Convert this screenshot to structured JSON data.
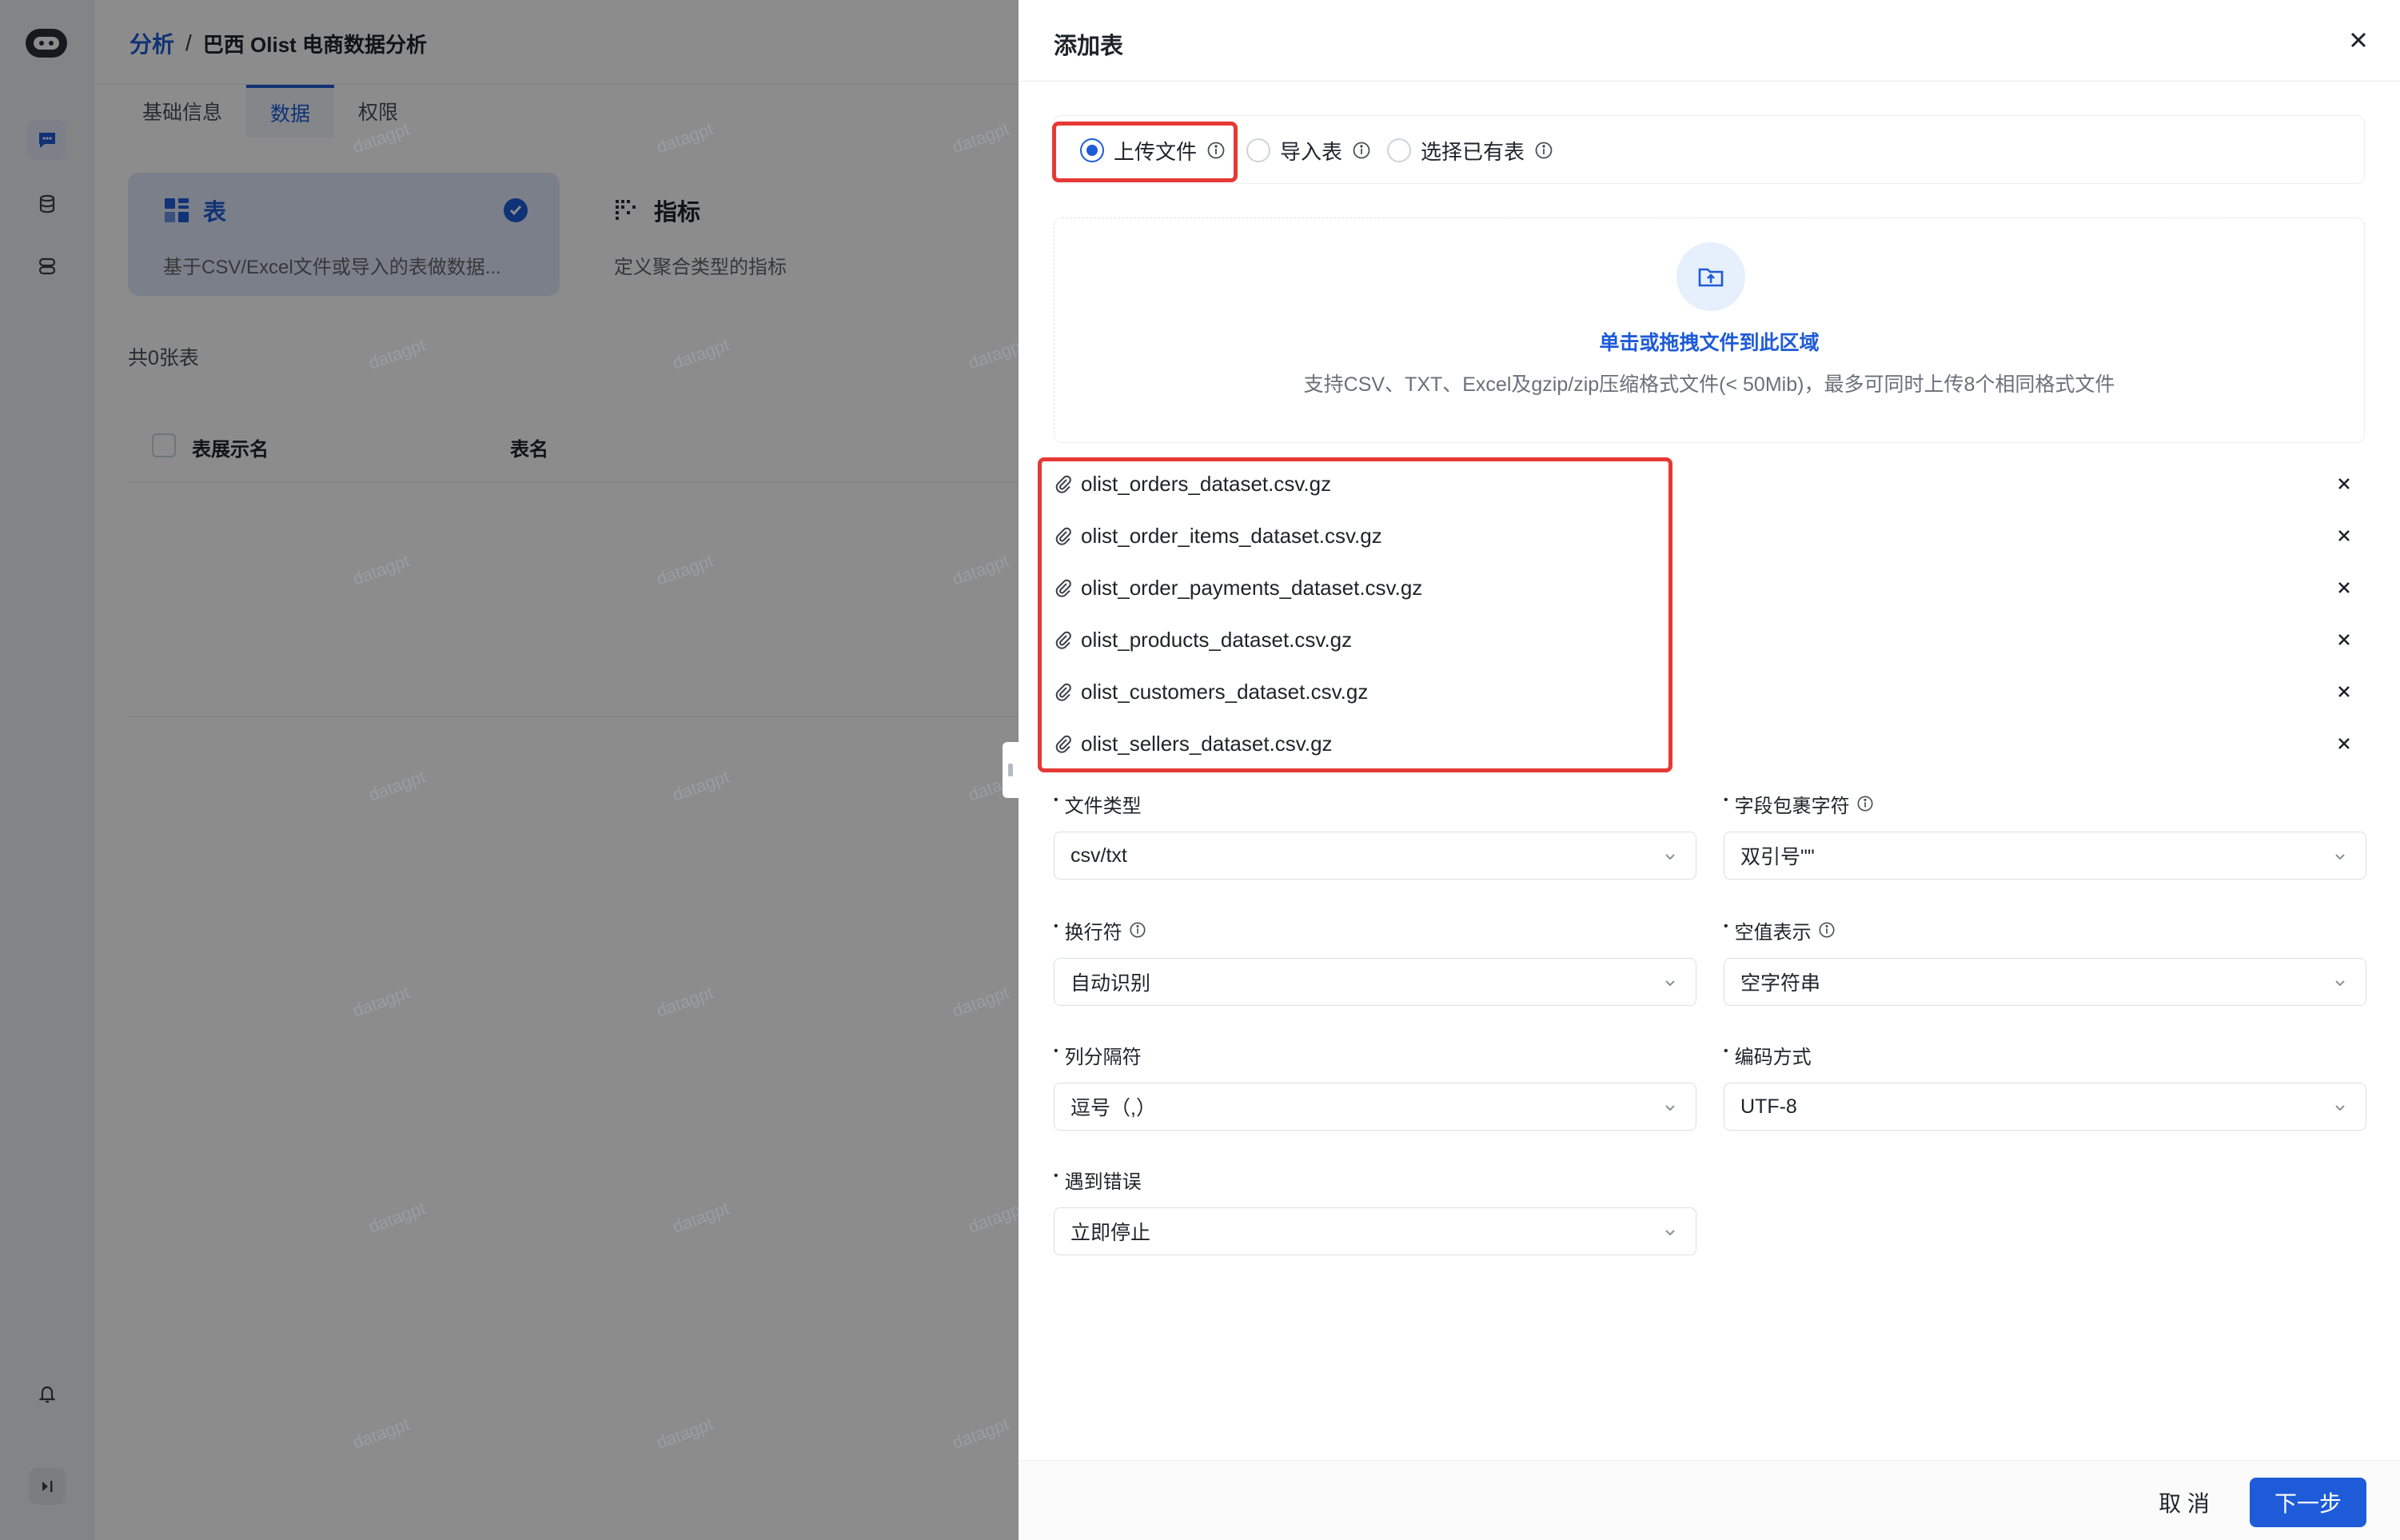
{
  "app": {
    "breadcrumb": {
      "root": "分析",
      "sep": "/",
      "current": "巴西 Olist 电商数据分析"
    },
    "tabs": [
      {
        "label": "基础信息"
      },
      {
        "label": "数据"
      },
      {
        "label": "权限"
      }
    ],
    "cards": [
      {
        "title": "表",
        "desc": "基于CSV/Excel文件或导入的表做数据..."
      },
      {
        "title": "指标",
        "desc": "定义聚合类型的指标"
      }
    ],
    "count_label": "共0张表",
    "table_headers": [
      "表展示名",
      "表名",
      "数据"
    ],
    "watermark": "datagpt"
  },
  "drawer": {
    "title": "添加表",
    "source_options": [
      {
        "label": "上传文件",
        "selected": true
      },
      {
        "label": "导入表",
        "selected": false
      },
      {
        "label": "选择已有表",
        "selected": false
      }
    ],
    "dropzone": {
      "title": "单击或拖拽文件到此区域",
      "subtitle": "支持CSV、TXT、Excel及gzip/zip压缩格式文件(< 50Mib)，最多可同时上传8个相同格式文件"
    },
    "files": [
      "olist_orders_dataset.csv.gz",
      "olist_order_items_dataset.csv.gz",
      "olist_order_payments_dataset.csv.gz",
      "olist_products_dataset.csv.gz",
      "olist_customers_dataset.csv.gz",
      "olist_sellers_dataset.csv.gz"
    ],
    "fields": {
      "file_type": {
        "label": "文件类型",
        "value": "csv/txt"
      },
      "quote_char": {
        "label": "字段包裹字符",
        "value": "双引号\"\""
      },
      "line_sep": {
        "label": "换行符",
        "value": "自动识别"
      },
      "null_repr": {
        "label": "空值表示",
        "value": "空字符串"
      },
      "col_sep": {
        "label": "列分隔符",
        "value": "逗号（,）"
      },
      "encoding": {
        "label": "编码方式",
        "value": "UTF-8"
      },
      "on_error": {
        "label": "遇到错误",
        "value": "立即停止"
      }
    },
    "buttons": {
      "cancel": "取 消",
      "next": "下一步"
    },
    "colors": {
      "accent": "#1e5bd8",
      "highlight": "#e53935"
    }
  }
}
